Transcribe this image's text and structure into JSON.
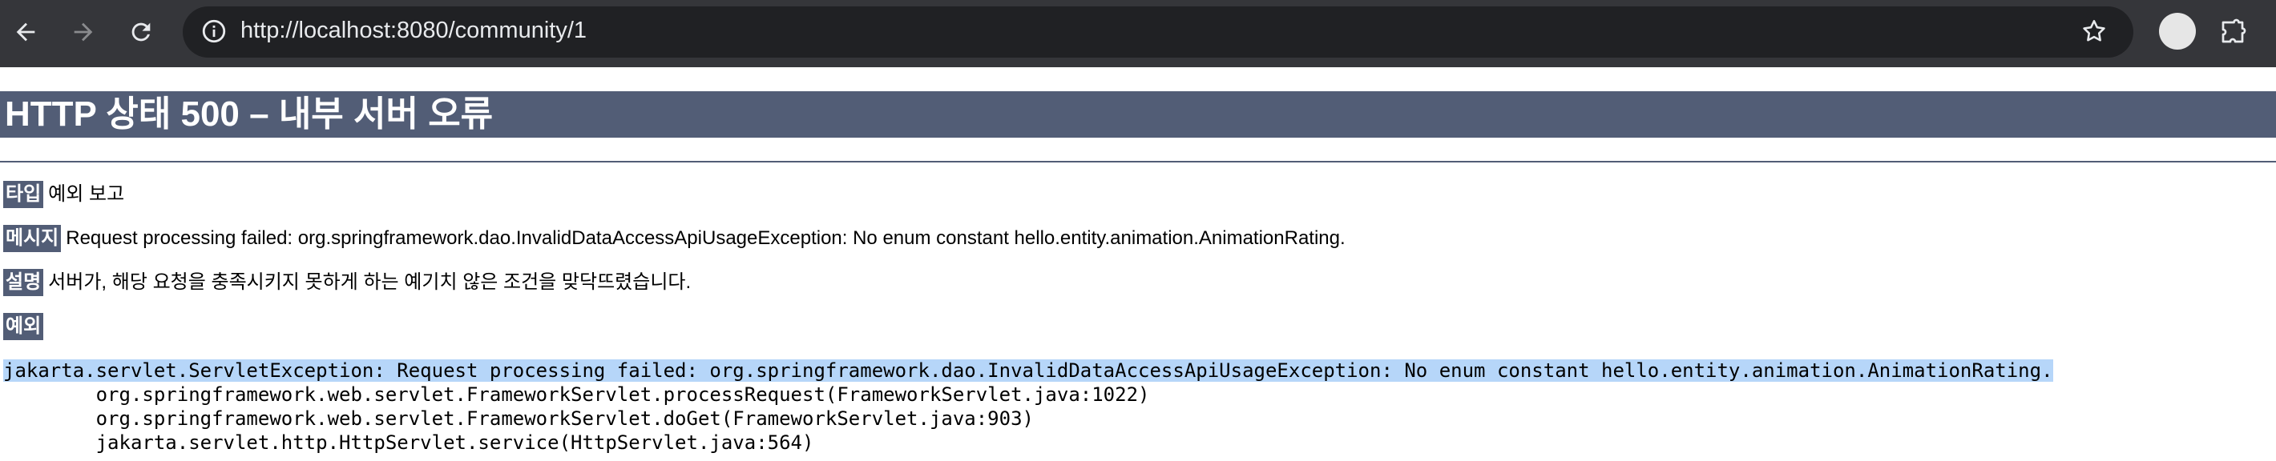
{
  "browser": {
    "url": "http://localhost:8080/community/1",
    "icons": [
      "back-arrow-icon",
      "forward-arrow-icon",
      "reload-icon",
      "site-info-icon",
      "bookmark-star-icon",
      "profile-avatar",
      "extensions-icon"
    ]
  },
  "error": {
    "title": "HTTP 상태 500 – 내부 서버 오류",
    "type_label": "타입",
    "type_value": "예외 보고",
    "message_label": "메시지",
    "message_value": "Request processing failed: org.springframework.dao.InvalidDataAccessApiUsageException: No enum constant hello.entity.animation.AnimationRating.",
    "description_label": "설명",
    "description_value": "서버가, 해당 요청을 충족시키지 못하게 하는 예기치 않은 조건을 맞닥뜨렸습니다.",
    "exception_label": "예외"
  },
  "stack": {
    "exception_line": "jakarta.servlet.ServletException: Request processing failed: org.springframework.dao.InvalidDataAccessApiUsageException: No enum constant hello.entity.animation.AnimationRating.",
    "frames": [
      "\torg.springframework.web.servlet.FrameworkServlet.processRequest(FrameworkServlet.java:1022)",
      "\torg.springframework.web.servlet.FrameworkServlet.doGet(FrameworkServlet.java:903)",
      "\tjakarta.servlet.http.HttpServlet.service(HttpServlet.java:564)"
    ]
  },
  "colors": {
    "chrome_bg": "#35363a",
    "omnibox_bg": "#202124",
    "header_bg": "#525d76",
    "selection": "#b6d6f9"
  }
}
